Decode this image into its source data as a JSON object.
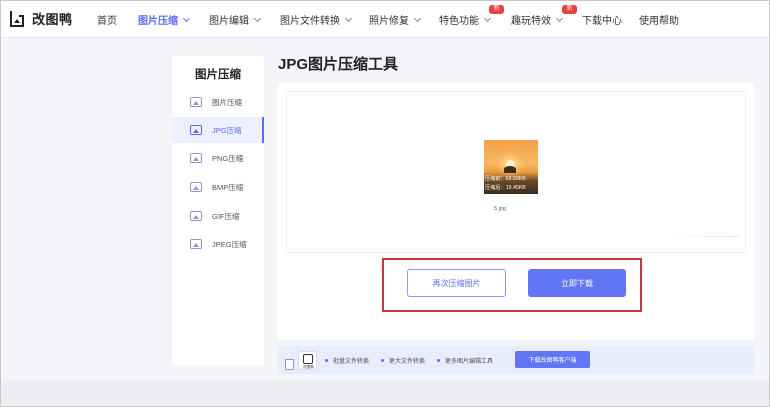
{
  "app": {
    "name": "改图鸭"
  },
  "nav": {
    "items": [
      {
        "label": "首页",
        "has_menu": false,
        "active": false,
        "badge": ""
      },
      {
        "label": "图片压缩",
        "has_menu": true,
        "active": true,
        "badge": ""
      },
      {
        "label": "图片编辑",
        "has_menu": true,
        "active": false,
        "badge": ""
      },
      {
        "label": "图片文件转换",
        "has_menu": true,
        "active": false,
        "badge": ""
      },
      {
        "label": "照片修复",
        "has_menu": true,
        "active": false,
        "badge": ""
      },
      {
        "label": "特色功能",
        "has_menu": true,
        "active": false,
        "badge": "新"
      },
      {
        "label": "趣玩特效",
        "has_menu": true,
        "active": false,
        "badge": "新"
      },
      {
        "label": "下载中心",
        "has_menu": false,
        "active": false,
        "badge": ""
      },
      {
        "label": "使用帮助",
        "has_menu": false,
        "active": false,
        "badge": ""
      }
    ]
  },
  "sidebar": {
    "title": "图片压缩",
    "items": [
      {
        "label": "图片压缩",
        "icon": "image-icon",
        "active": false
      },
      {
        "label": "JPG压缩",
        "icon": "image-icon",
        "active": true
      },
      {
        "label": "PNG压缩",
        "icon": "image-icon",
        "active": false
      },
      {
        "label": "BMP压缩",
        "icon": "image-icon",
        "active": false
      },
      {
        "label": "GIF压缩",
        "icon": "image-icon",
        "active": false
      },
      {
        "label": "JPEG压缩",
        "icon": "image-icon",
        "active": false
      }
    ]
  },
  "main": {
    "title": "JPG图片压缩工具",
    "file": {
      "before_label": "压缩前：",
      "before_size": "63.09KB",
      "after_label": "压缩后：",
      "after_size": "19.45KB",
      "name": "5.jpg"
    },
    "buttons": {
      "recompress": "再次压缩图片",
      "download": "立即下载"
    }
  },
  "bottom_bar": {
    "app_icon_label": "改图鸭",
    "features": [
      "批量文件转换",
      "更大文件转换",
      "更多图片编辑工具"
    ],
    "download_client": "下载改图鸭客户端"
  },
  "colors": {
    "accent": "#5b6cf7",
    "primary_button": "#6275f5",
    "badge": "#e8413a",
    "highlight_border": "#c0393b"
  }
}
